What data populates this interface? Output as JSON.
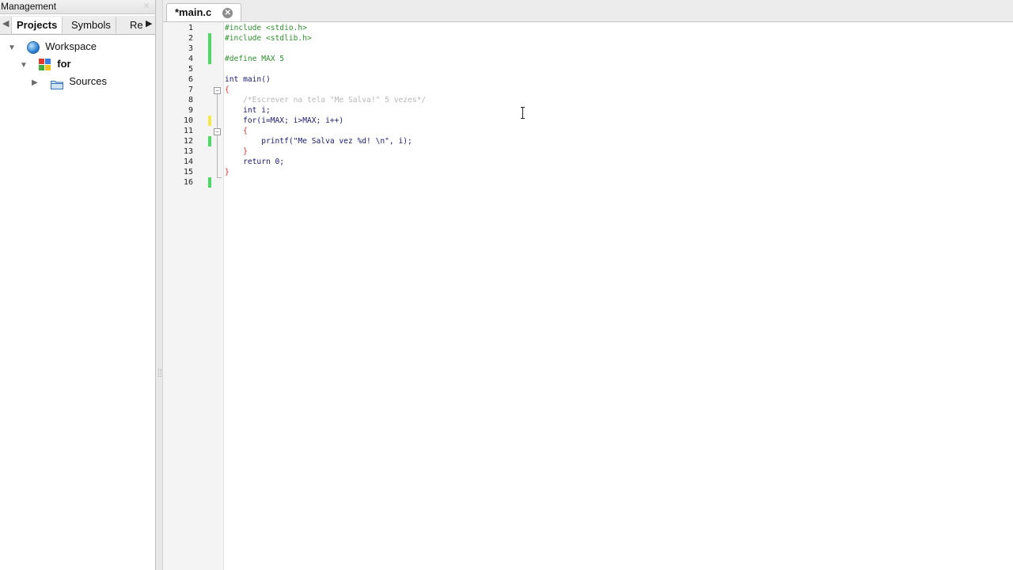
{
  "management": {
    "title": "Management",
    "tabs": [
      "Projects",
      "Symbols",
      "Re"
    ],
    "tree": [
      {
        "label": "Workspace",
        "icon": "workspace-icon"
      },
      {
        "label": "for",
        "icon": "project-icon"
      },
      {
        "label": "Sources",
        "icon": "folder-icon"
      }
    ]
  },
  "editor": {
    "tab_label": "*main.c",
    "line_numbers": [
      "1",
      "2",
      "3",
      "4",
      "5",
      "6",
      "7",
      "8",
      "9",
      "10",
      "11",
      "12",
      "13",
      "14",
      "15",
      "16"
    ],
    "lines": [
      "#include <stdio.h>",
      "#include <stdlib.h>",
      "",
      "#define MAX 5",
      "",
      "int main()",
      "{",
      "    /*Escrever na tela \"Me Salva!\" 5 vezes*/",
      "    int i;",
      "    for(i=MAX; i>MAX; i++)",
      "    {",
      "        printf(\"Me Salva vez %d! \\n\", i);",
      "    }",
      "    return 0;",
      "}",
      ""
    ]
  },
  "colors": {
    "preprocessor": "#2f8f2f",
    "keyword": "#1a1a6e",
    "comment": "#b8b8b8",
    "string": "#1c2fa8",
    "number": "#e0257a",
    "brace": "#d22b2b",
    "changed_saved": "#4cd964",
    "changed_unsaved": "#f5e84a"
  }
}
